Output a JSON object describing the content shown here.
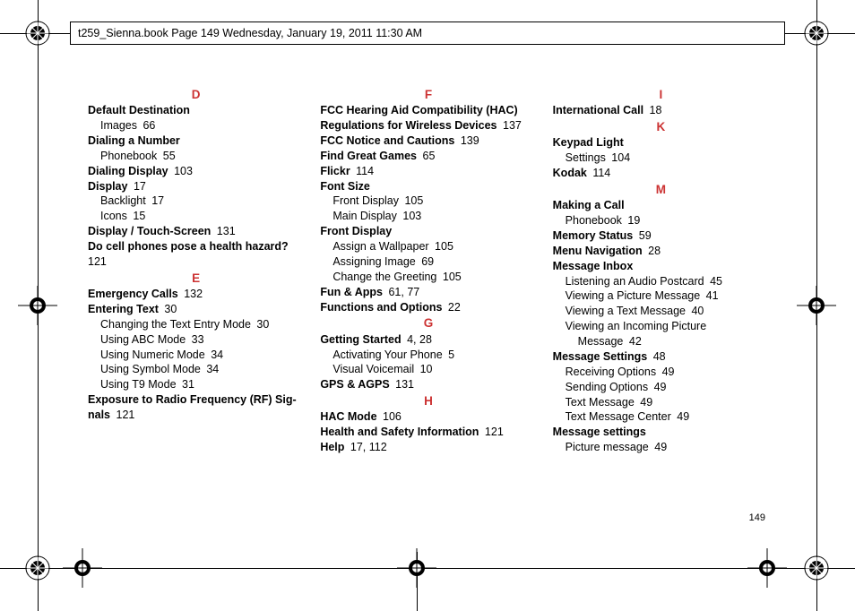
{
  "header": "t259_Sienna.book  Page 149  Wednesday, January 19, 2011  11:30 AM",
  "page_number": "149",
  "columns": [
    [
      {
        "type": "letter",
        "text": "D"
      },
      {
        "type": "main",
        "text": "Default Destination",
        "pg": ""
      },
      {
        "type": "sub",
        "text": "Images",
        "pg": "66"
      },
      {
        "type": "main",
        "text": "Dialing a Number",
        "pg": ""
      },
      {
        "type": "sub",
        "text": "Phonebook",
        "pg": "55"
      },
      {
        "type": "main",
        "text": "Dialing Display",
        "pg": "103"
      },
      {
        "type": "main",
        "text": "Display",
        "pg": "17"
      },
      {
        "type": "sub",
        "text": "Backlight",
        "pg": "17"
      },
      {
        "type": "sub",
        "text": "Icons",
        "pg": "15"
      },
      {
        "type": "main",
        "text": "Display / Touch-Screen",
        "pg": "131"
      },
      {
        "type": "main",
        "text": "Do cell phones pose a health hazard?",
        "pg": ""
      },
      {
        "type": "cont",
        "text": "121"
      },
      {
        "type": "letter",
        "text": "E"
      },
      {
        "type": "main",
        "text": "Emergency Calls",
        "pg": "132"
      },
      {
        "type": "main",
        "text": "Entering Text",
        "pg": "30"
      },
      {
        "type": "sub",
        "text": "Changing the Text Entry Mode",
        "pg": "30"
      },
      {
        "type": "sub",
        "text": "Using ABC Mode",
        "pg": "33"
      },
      {
        "type": "sub",
        "text": "Using Numeric Mode",
        "pg": "34"
      },
      {
        "type": "sub",
        "text": "Using Symbol Mode",
        "pg": "34"
      },
      {
        "type": "sub",
        "text": "Using T9 Mode",
        "pg": "31"
      },
      {
        "type": "main",
        "text": "Exposure to Radio Frequency (RF) Sig-",
        "pg": ""
      },
      {
        "type": "mainwrap",
        "text": "nals",
        "pg": "121"
      }
    ],
    [
      {
        "type": "letter",
        "text": "F"
      },
      {
        "type": "main",
        "text": "FCC Hearing Aid Compatibility (HAC)",
        "pg": ""
      },
      {
        "type": "mainwrap",
        "text": "Regulations for Wireless Devices",
        "pg": "137"
      },
      {
        "type": "main",
        "text": "FCC Notice and Cautions",
        "pg": "139"
      },
      {
        "type": "main",
        "text": "Find Great Games",
        "pg": "65"
      },
      {
        "type": "main",
        "text": "Flickr",
        "pg": "114"
      },
      {
        "type": "main",
        "text": "Font Size",
        "pg": ""
      },
      {
        "type": "sub",
        "text": "Front Display",
        "pg": "105"
      },
      {
        "type": "sub",
        "text": "Main Display",
        "pg": "103"
      },
      {
        "type": "main",
        "text": "Front Display",
        "pg": ""
      },
      {
        "type": "sub",
        "text": "Assign a Wallpaper",
        "pg": "105"
      },
      {
        "type": "sub",
        "text": "Assigning Image",
        "pg": "69"
      },
      {
        "type": "sub",
        "text": "Change the Greeting",
        "pg": "105"
      },
      {
        "type": "main",
        "text": "Fun & Apps",
        "pg": "61, 77"
      },
      {
        "type": "main",
        "text": "Functions and Options",
        "pg": "22"
      },
      {
        "type": "letter",
        "text": "G"
      },
      {
        "type": "main",
        "text": "Getting Started",
        "pg": "4, 28"
      },
      {
        "type": "sub",
        "text": "Activating Your Phone",
        "pg": "5"
      },
      {
        "type": "sub",
        "text": "Visual Voicemail",
        "pg": "10"
      },
      {
        "type": "main",
        "text": "GPS & AGPS",
        "pg": "131"
      },
      {
        "type": "letter",
        "text": "H"
      },
      {
        "type": "main",
        "text": "HAC Mode",
        "pg": "106"
      },
      {
        "type": "main",
        "text": "Health and Safety Information",
        "pg": "121"
      },
      {
        "type": "main",
        "text": "Help",
        "pg": "17, 112"
      }
    ],
    [
      {
        "type": "letter",
        "text": "I"
      },
      {
        "type": "main",
        "text": "International Call",
        "pg": "18"
      },
      {
        "type": "letter",
        "text": "K"
      },
      {
        "type": "main",
        "text": "Keypad Light",
        "pg": ""
      },
      {
        "type": "sub",
        "text": "Settings",
        "pg": "104"
      },
      {
        "type": "main",
        "text": "Kodak",
        "pg": "114"
      },
      {
        "type": "letter",
        "text": "M"
      },
      {
        "type": "main",
        "text": "Making a Call",
        "pg": ""
      },
      {
        "type": "sub",
        "text": "Phonebook",
        "pg": "19"
      },
      {
        "type": "main",
        "text": "Memory Status",
        "pg": "59"
      },
      {
        "type": "main",
        "text": "Menu Navigation",
        "pg": "28"
      },
      {
        "type": "main",
        "text": "Message Inbox",
        "pg": ""
      },
      {
        "type": "sub",
        "text": "Listening an Audio Postcard",
        "pg": "45"
      },
      {
        "type": "sub",
        "text": "Viewing a Picture Message",
        "pg": "41"
      },
      {
        "type": "sub",
        "text": "Viewing a Text Message",
        "pg": "40"
      },
      {
        "type": "sub",
        "text": "Viewing an Incoming Picture",
        "pg": ""
      },
      {
        "type": "sub2",
        "text": "Message",
        "pg": "42"
      },
      {
        "type": "main",
        "text": "Message Settings",
        "pg": "48"
      },
      {
        "type": "sub",
        "text": "Receiving Options",
        "pg": "49"
      },
      {
        "type": "sub",
        "text": "Sending Options",
        "pg": "49"
      },
      {
        "type": "sub",
        "text": "Text Message",
        "pg": "49"
      },
      {
        "type": "sub",
        "text": "Text Message Center",
        "pg": "49"
      },
      {
        "type": "main",
        "text": "Message settings",
        "pg": ""
      },
      {
        "type": "sub",
        "text": "Picture message",
        "pg": "49"
      }
    ]
  ]
}
